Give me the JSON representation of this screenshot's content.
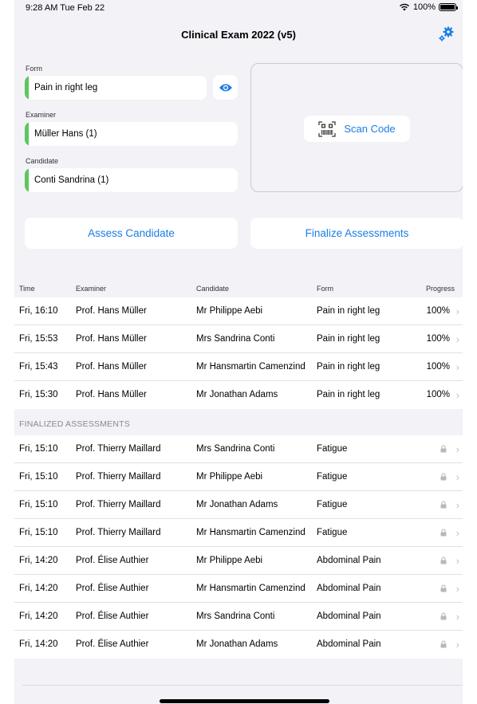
{
  "status": {
    "time": "9:28 AM  Tue Feb 22",
    "battery": "100%"
  },
  "nav": {
    "title": "Clinical Exam 2022 (v5)"
  },
  "form": {
    "form_label": "Form",
    "form_value": "Pain in right leg",
    "examiner_label": "Examiner",
    "examiner_value": "Müller Hans (1)",
    "candidate_label": "Candidate",
    "candidate_value": "Conti Sandrina (1)"
  },
  "scan": {
    "label": "Scan Code"
  },
  "actions": {
    "assess": "Assess Candidate",
    "finalize": "Finalize Assessments"
  },
  "table": {
    "headers": {
      "time": "Time",
      "examiner": "Examiner",
      "candidate": "Candidate",
      "form": "Form",
      "progress": "Progress"
    },
    "active_rows": [
      {
        "time": "Fri, 16:10",
        "examiner": "Prof. Hans Müller",
        "candidate": "Mr Philippe Aebi",
        "form": "Pain in right leg",
        "progress": "100%"
      },
      {
        "time": "Fri, 15:53",
        "examiner": "Prof. Hans Müller",
        "candidate": "Mrs Sandrina Conti",
        "form": "Pain in right leg",
        "progress": "100%"
      },
      {
        "time": "Fri, 15:43",
        "examiner": "Prof. Hans Müller",
        "candidate": "Mr Hansmartin Camenzind",
        "form": "Pain in right leg",
        "progress": "100%"
      },
      {
        "time": "Fri, 15:30",
        "examiner": "Prof. Hans Müller",
        "candidate": "Mr Jonathan Adams",
        "form": "Pain in right leg",
        "progress": "100%"
      }
    ],
    "finalized_header": "FINALIZED ASSESSMENTS",
    "finalized_rows": [
      {
        "time": "Fri, 15:10",
        "examiner": "Prof. Thierry Maillard",
        "candidate": "Mrs Sandrina Conti",
        "form": "Fatigue"
      },
      {
        "time": "Fri, 15:10",
        "examiner": "Prof. Thierry Maillard",
        "candidate": "Mr Philippe Aebi",
        "form": "Fatigue"
      },
      {
        "time": "Fri, 15:10",
        "examiner": "Prof. Thierry Maillard",
        "candidate": "Mr Jonathan Adams",
        "form": "Fatigue"
      },
      {
        "time": "Fri, 15:10",
        "examiner": "Prof. Thierry Maillard",
        "candidate": "Mr Hansmartin Camenzind",
        "form": "Fatigue"
      },
      {
        "time": "Fri, 14:20",
        "examiner": "Prof. Élise Authier",
        "candidate": "Mr Philippe Aebi",
        "form": "Abdominal Pain"
      },
      {
        "time": "Fri, 14:20",
        "examiner": "Prof. Élise Authier",
        "candidate": "Mr Hansmartin Camenzind",
        "form": "Abdominal Pain"
      },
      {
        "time": "Fri, 14:20",
        "examiner": "Prof. Élise Authier",
        "candidate": "Mrs Sandrina Conti",
        "form": "Abdominal Pain"
      },
      {
        "time": "Fri, 14:20",
        "examiner": "Prof. Élise Authier",
        "candidate": "Mr Jonathan Adams",
        "form": "Abdominal Pain"
      }
    ]
  },
  "icons": {
    "settings": "gear-icon",
    "preview": "eye-icon",
    "scan": "qr-code-icon",
    "lock": "lock-icon",
    "chevron": "chevron-right-icon",
    "wifi": "wifi-icon",
    "battery": "battery-icon"
  },
  "colors": {
    "accent": "#1a7ee6",
    "valid_indicator": "#5cc65c",
    "background": "#f2f2f7"
  }
}
